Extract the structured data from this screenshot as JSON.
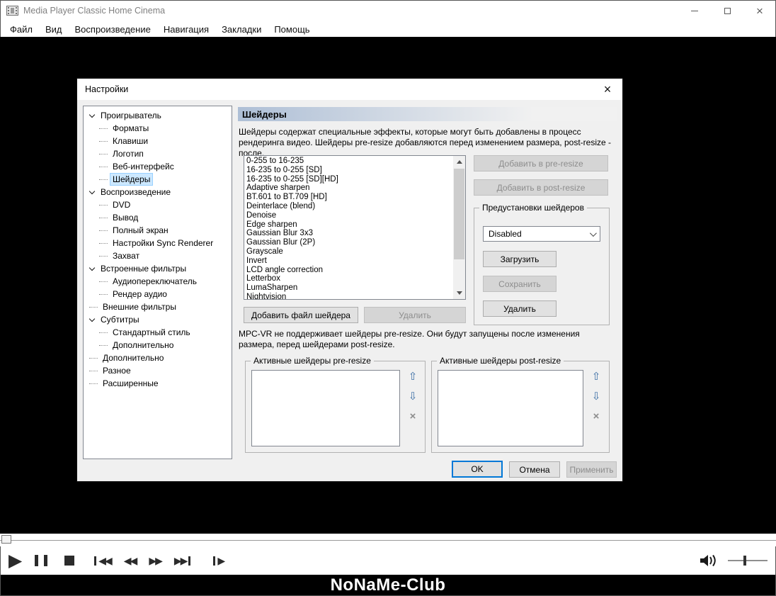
{
  "window": {
    "title": "Media Player Classic Home Cinema",
    "menu": [
      "Файл",
      "Вид",
      "Воспроизведение",
      "Навигация",
      "Закладки",
      "Помощь"
    ]
  },
  "dialog": {
    "title": "Настройки",
    "close_glyph": "×",
    "tree": [
      {
        "label": "Проигрыватель",
        "type": "parent"
      },
      {
        "label": "Форматы",
        "type": "child"
      },
      {
        "label": "Клавиши",
        "type": "child"
      },
      {
        "label": "Логотип",
        "type": "child"
      },
      {
        "label": "Веб-интерфейс",
        "type": "child"
      },
      {
        "label": "Шейдеры",
        "type": "child",
        "selected": true
      },
      {
        "label": "Воспроизведение",
        "type": "parent"
      },
      {
        "label": "DVD",
        "type": "child"
      },
      {
        "label": "Вывод",
        "type": "child"
      },
      {
        "label": "Полный экран",
        "type": "child"
      },
      {
        "label": "Настройки Sync Renderer",
        "type": "child"
      },
      {
        "label": "Захват",
        "type": "child"
      },
      {
        "label": "Встроенные фильтры",
        "type": "parent"
      },
      {
        "label": "Аудиопереключатель",
        "type": "child"
      },
      {
        "label": "Рендер аудио",
        "type": "child"
      },
      {
        "label": "Внешние фильтры",
        "type": "leaf"
      },
      {
        "label": "Субтитры",
        "type": "parent"
      },
      {
        "label": "Стандартный стиль",
        "type": "child"
      },
      {
        "label": "Дополнительно",
        "type": "child"
      },
      {
        "label": "Дополнительно",
        "type": "leaf"
      },
      {
        "label": "Разное",
        "type": "leaf"
      },
      {
        "label": "Расширенные",
        "type": "leaf"
      }
    ],
    "panel": {
      "header": "Шейдеры",
      "description": "Шейдеры содержат специальные эффекты, которые могут быть добавлены в процесс рендеринга видео. Шейдеры pre-resize добавляются перед изменением размера, post-resize - после.",
      "shaders": [
        "0-255 to 16-235",
        "16-235 to 0-255 [SD]",
        "16-235 to 0-255 [SD][HD]",
        "Adaptive sharpen",
        "BT.601 to BT.709 [HD]",
        "Deinterlace (blend)",
        "Denoise",
        "Edge sharpen",
        "Gaussian Blur 3x3",
        "Gaussian Blur (2P)",
        "Grayscale",
        "Invert",
        "LCD angle correction",
        "Letterbox",
        "LumaSharpen",
        "Nightvision"
      ],
      "add_pre_label": "Добавить в pre-resize",
      "add_post_label": "Добавить в post-resize",
      "presets": {
        "title": "Предустановки шейдеров",
        "value": "Disabled",
        "load_label": "Загрузить",
        "save_label": "Сохранить",
        "delete_label": "Удалить"
      },
      "add_file_label": "Добавить файл шейдера",
      "remove_label": "Удалить",
      "note": "MPC-VR не поддерживает шейдеры pre-resize. Они будут запущены после изменения размера, перед шейдерами post-resize.",
      "pre_group_title": "Активные шейдеры pre-resize",
      "post_group_title": "Активные шейдеры post-resize",
      "list_buttons": {
        "up": "⇧",
        "down": "⇩",
        "remove": "×"
      }
    },
    "footer_buttons": {
      "ok": "OK",
      "cancel": "Отмена",
      "apply": "Применить"
    }
  },
  "player": {
    "glyphs": {
      "play": "▶",
      "double_left": "◀◀",
      "double_right": "▶▶"
    }
  },
  "watermark": "NoNaMe-Club",
  "colors": {
    "accent_focus": "#0078d7",
    "tree_selection_bg": "#cce8ff",
    "header_gradient_start": "#aebfd6"
  }
}
